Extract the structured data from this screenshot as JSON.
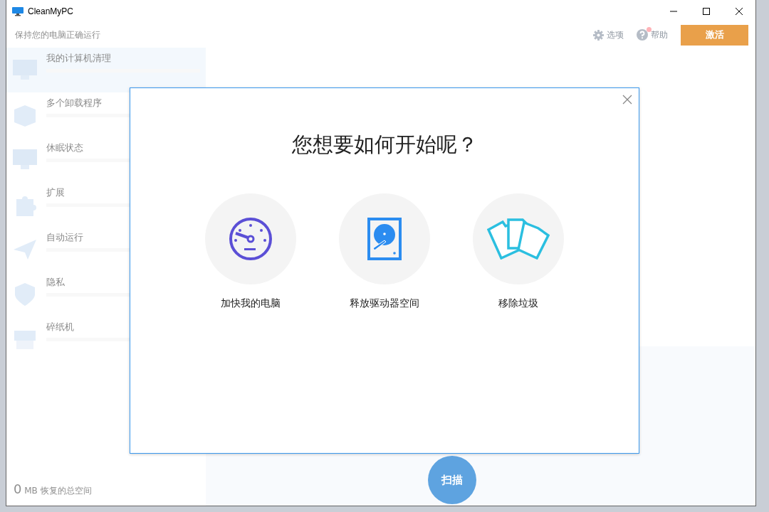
{
  "window": {
    "title": "CleanMyPC"
  },
  "header": {
    "subtitle": "保持您的电脑正确运行",
    "options_label": "选项",
    "help_label": "帮助",
    "help_notification": true,
    "activate_button": "激活"
  },
  "sidebar": {
    "items": [
      {
        "label": "我的计算机清理",
        "selected": true
      },
      {
        "label": "多个卸载程序",
        "selected": false
      },
      {
        "label": "休眠状态",
        "selected": false
      },
      {
        "label": "扩展",
        "selected": false
      },
      {
        "label": "自动运行",
        "selected": false
      },
      {
        "label": "隐私",
        "selected": false
      },
      {
        "label": "碎纸机",
        "selected": false
      }
    ],
    "footer": {
      "amount": "0",
      "unit": "MB",
      "label": "恢复的总空间"
    }
  },
  "main": {
    "scan_button": "扫描"
  },
  "dialog": {
    "title": "您想要如何开始呢？",
    "options": [
      {
        "label": "加快我的电脑"
      },
      {
        "label": "释放驱动器空间"
      },
      {
        "label": "移除垃圾"
      }
    ]
  }
}
